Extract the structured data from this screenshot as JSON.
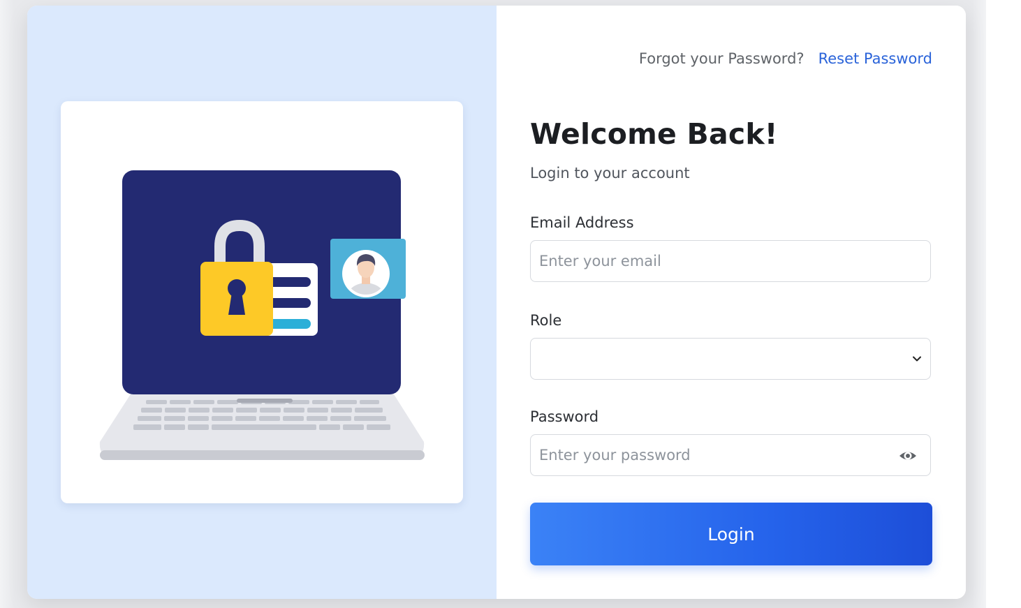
{
  "header": {
    "forgot_text": "Forgot your Password?",
    "reset_link": "Reset Password"
  },
  "form": {
    "title": "Welcome Back!",
    "subtitle": "Login to your account",
    "email_label": "Email Address",
    "email_placeholder": "Enter your email",
    "role_label": "Role",
    "role_value": "",
    "password_label": "Password",
    "password_placeholder": "Enter your password",
    "login_button": "Login"
  },
  "colors": {
    "left_panel_bg": "#dbe9fd",
    "link": "#2a63d9",
    "button_start": "#3b82f6",
    "button_end": "#1d4ed8"
  },
  "icons": {
    "password_toggle": "eye-icon",
    "select_arrow": "chevron-down-icon",
    "illustration": "laptop-lock-illustration"
  }
}
